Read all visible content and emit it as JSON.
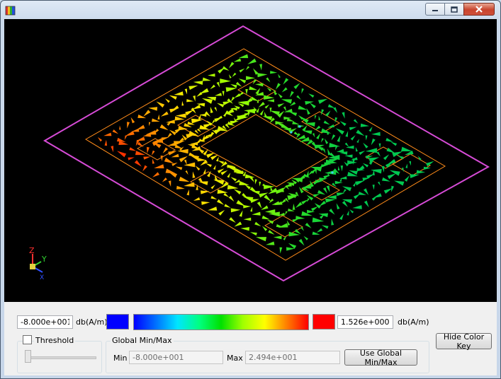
{
  "window": {
    "title": "",
    "icons": {
      "app": "colorbar-app-icon",
      "minimize": "minimize-icon",
      "maximize": "maximize-icon",
      "close": "close-icon"
    }
  },
  "viewport": {
    "background": "#000000",
    "axes": {
      "z": "Z",
      "y": "Y",
      "x": "X"
    },
    "colors": {
      "outer_boundary": "#d64bd6",
      "trace_outline": "#ff8c1a"
    }
  },
  "color_key": {
    "min_value": "-8.000e+001",
    "min_unit": "db(A/m)",
    "max_value": "1.526e+000",
    "max_unit": "db(A/m)",
    "min_color": "#0000ff",
    "max_color": "#ff0000",
    "gradient": [
      "#0000ff",
      "#0070ff",
      "#00e5ff",
      "#00ff80",
      "#00e000",
      "#a0ff00",
      "#ffff00",
      "#ff8000",
      "#ff0000"
    ],
    "hide_button": "Hide Color Key"
  },
  "threshold": {
    "label": "Threshold",
    "checked": false,
    "slider_value": 0
  },
  "global_minmax": {
    "title": "Global Min/Max",
    "min_label": "Min",
    "min_value": "-8.000e+001",
    "max_label": "Max",
    "max_value": "2.494e+001",
    "use_button": "Use Global Min/Max"
  }
}
